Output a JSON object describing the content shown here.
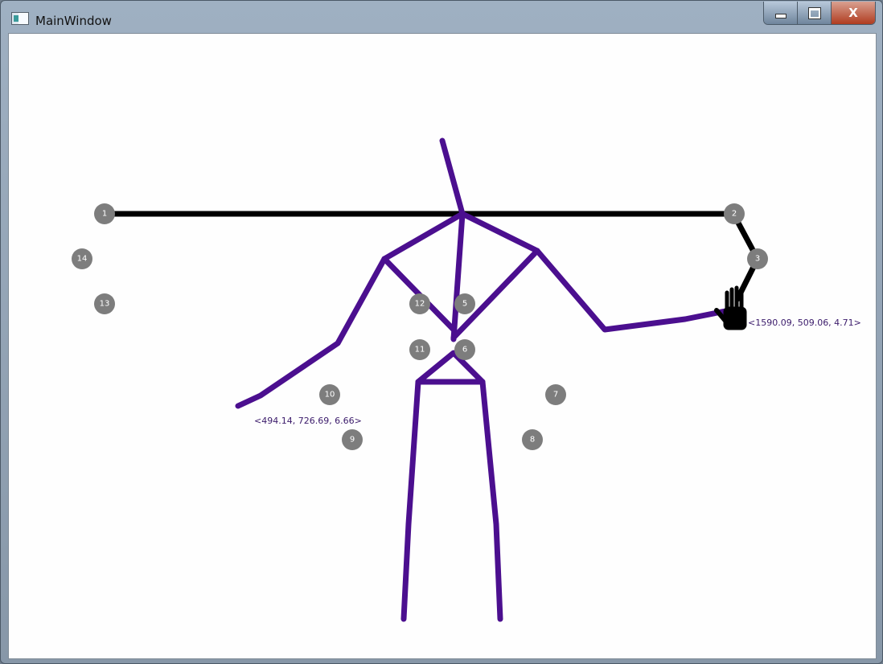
{
  "window": {
    "title": "MainWindow",
    "icons": {
      "app": "window-app-icon",
      "minimize": "minimize-icon",
      "maximize": "maximize-icon",
      "close": "close-icon"
    },
    "close_glyph": "X"
  },
  "canvas": {
    "colors": {
      "skeleton": "#4b0f8f",
      "connector": "#000000",
      "joint_fill": "#7d7d7d",
      "hand": "#000000"
    },
    "joints": [
      "1",
      "2",
      "3",
      "5",
      "6",
      "7",
      "8",
      "9",
      "10",
      "11",
      "12",
      "13",
      "14"
    ],
    "coord_labels": {
      "left_hand": "<494.14, 726.69, 6.66>",
      "right_hand": "<1590.09, 509.06, 4.71>"
    },
    "cursor_icon": "hand-cursor-icon"
  }
}
